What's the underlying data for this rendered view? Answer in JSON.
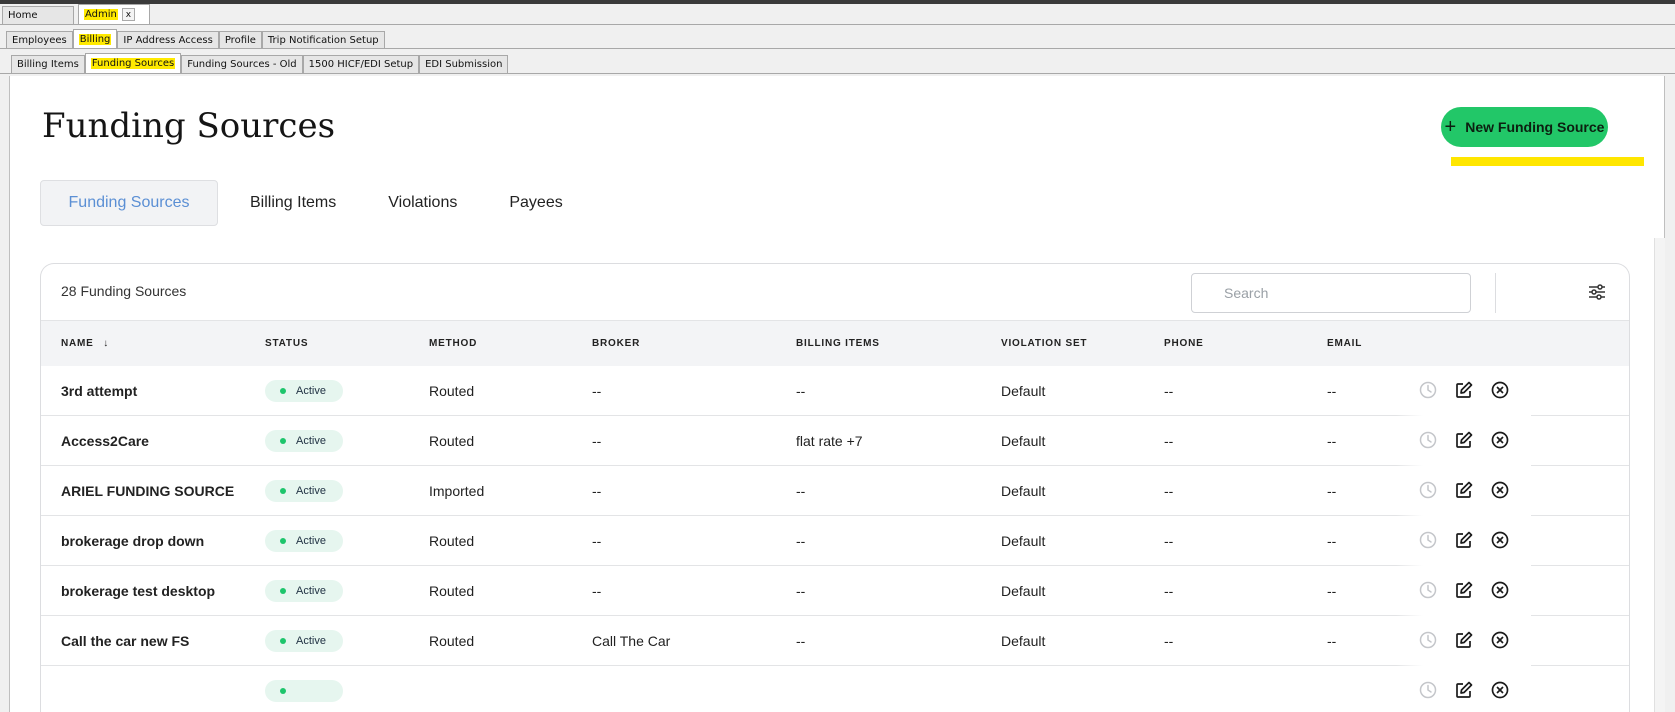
{
  "window_tabs": [
    {
      "label": "Home",
      "active": false
    },
    {
      "label": "Admin",
      "active": true,
      "closable": true
    }
  ],
  "close_glyph": "x",
  "admin_tabs": [
    "Employees",
    "Billing",
    "IP Address Access",
    "Profile",
    "Trip Notification Setup"
  ],
  "billing_tabs": [
    "Billing Items",
    "Funding Sources",
    "Funding Sources - Old",
    "1500 HICF/EDI Setup",
    "EDI Submission"
  ],
  "page": {
    "title": "Funding Sources",
    "new_button": "New Funding Source",
    "sub_tabs": [
      "Funding Sources",
      "Billing Items",
      "Violations",
      "Payees"
    ],
    "active_sub_tab": "Funding Sources"
  },
  "table": {
    "count_label": "28 Funding Sources",
    "search_placeholder": "Search",
    "sort_glyph": "↓",
    "columns": [
      "NAME",
      "STATUS",
      "METHOD",
      "BROKER",
      "BILLING ITEMS",
      "VIOLATION SET",
      "PHONE",
      "EMAIL"
    ],
    "rows": [
      {
        "name": "3rd attempt",
        "status": "Active",
        "method": "Routed",
        "broker": "--",
        "billing_items": "--",
        "violation_set": "Default",
        "phone": "--",
        "email": "--"
      },
      {
        "name": "Access2Care",
        "status": "Active",
        "method": "Routed",
        "broker": "--",
        "billing_items": "flat rate +7",
        "violation_set": "Default",
        "phone": "--",
        "email": "--"
      },
      {
        "name": "ARIEL FUNDING SOURCE",
        "status": "Active",
        "method": "Imported",
        "broker": "--",
        "billing_items": "--",
        "violation_set": "Default",
        "phone": "--",
        "email": "--"
      },
      {
        "name": "brokerage drop down",
        "status": "Active",
        "method": "Routed",
        "broker": "--",
        "billing_items": "--",
        "violation_set": "Default",
        "phone": "--",
        "email": "--"
      },
      {
        "name": "brokerage test desktop",
        "status": "Active",
        "method": "Routed",
        "broker": "--",
        "billing_items": "--",
        "violation_set": "Default",
        "phone": "--",
        "email": "--"
      },
      {
        "name": "Call the car new FS",
        "status": "Active",
        "method": "Routed",
        "broker": "Call The Car",
        "billing_items": "--",
        "violation_set": "Default",
        "phone": "--",
        "email": "--"
      }
    ],
    "row_actions": [
      "history-icon",
      "edit-icon",
      "delete-icon"
    ]
  },
  "colors": {
    "accent_green": "#22c768",
    "active_tab_text": "#5b8fd4",
    "status_dot": "#1ec56c",
    "highlight_yellow": "#ffea00"
  }
}
